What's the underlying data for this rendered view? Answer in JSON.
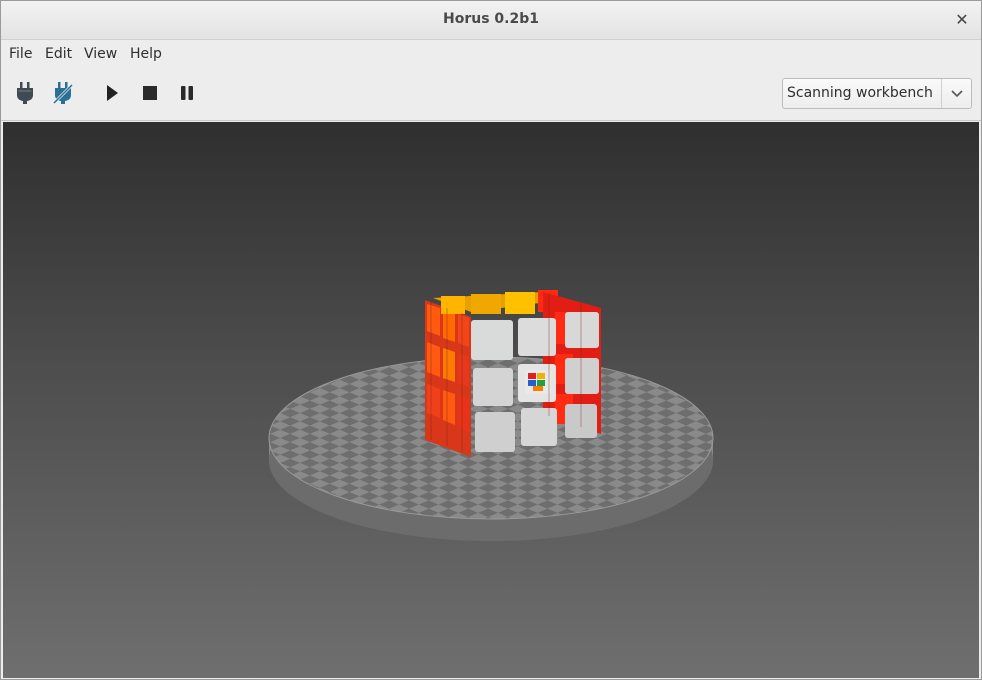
{
  "window": {
    "title": "Horus 0.2b1"
  },
  "menu": {
    "file": "File",
    "edit": "Edit",
    "view": "View",
    "help": "Help"
  },
  "toolbar": {
    "tools": [
      "connect-icon",
      "disconnect-icon",
      "play-icon",
      "stop-icon",
      "pause-icon"
    ],
    "workbench": {
      "selected": "Scanning workbench"
    }
  },
  "viewport": {
    "content": "3D point cloud of a Rubik's cube on a checkered turntable",
    "background_colors": [
      "#2f2f2f",
      "#6f6f6f"
    ]
  }
}
